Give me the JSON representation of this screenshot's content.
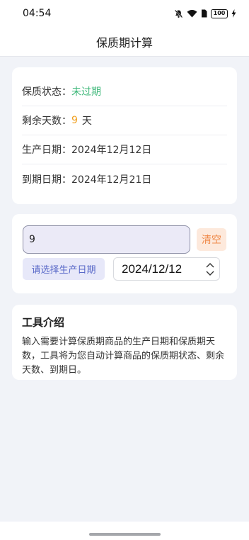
{
  "status_bar": {
    "time": "04:54",
    "battery": "100",
    "icons": [
      "mute-icon",
      "wifi-icon",
      "sim-icon",
      "battery-icon",
      "charging-icon"
    ]
  },
  "header": {
    "title": "保质期计算"
  },
  "info": {
    "status_label": "保质状态：",
    "status_value": "未过期",
    "remaining_label": "剩余天数：",
    "remaining_value": "9",
    "remaining_unit": "天",
    "production_label": "生产日期：",
    "production_value": "2024年12月12日",
    "expiry_label": "到期日期：",
    "expiry_value": "2024年12月21日"
  },
  "input": {
    "days_value": "9",
    "clear_label": "清空",
    "select_date_label": "请选择生产日期",
    "date_value": "2024/12/12"
  },
  "intro": {
    "title": "工具介绍",
    "text": "输入需要计算保质期商品的生产日期和保质期天数，工具将为您自动计算商品的保质期状态、剩余天数、到期日。"
  },
  "colors": {
    "status_ok": "#3fb87a",
    "days_accent": "#f0a020",
    "clear_button_text": "#f08a4a",
    "date_button_text": "#5868c8"
  }
}
